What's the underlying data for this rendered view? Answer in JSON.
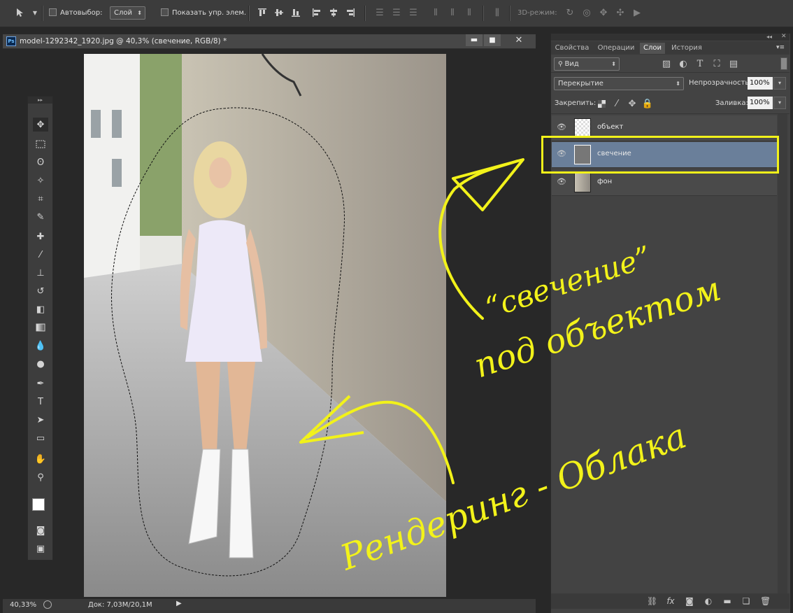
{
  "options_bar": {
    "autoselect_label": "Автовыбор:",
    "layer_select_value": "Слой",
    "show_controls_label": "Показать упр. элем.",
    "mode_3d_label": "3D-режим:"
  },
  "document": {
    "title": "model-1292342_1920.jpg @ 40,3% (свечение, RGB/8) *",
    "app_badge": "Ps",
    "zoom": "40,33%",
    "doc_info": "Док: 7,03M/20,1M"
  },
  "panel": {
    "tabs": [
      "Свойства",
      "Операции",
      "Слои",
      "История"
    ],
    "active_tab": "Слои",
    "filter_value": "Вид",
    "blend_mode": "Перекрытие",
    "opacity_label": "Непрозрачность:",
    "opacity_value": "100%",
    "lock_label": "Закрепить:",
    "fill_label": "Заливка:",
    "fill_value": "100%",
    "layers": [
      {
        "name": "объект",
        "selected": false
      },
      {
        "name": "свечение",
        "selected": true
      },
      {
        "name": "фон",
        "selected": false
      }
    ]
  },
  "annotations": {
    "quote_text": "“свечение”",
    "under_text": "под объектом",
    "render_text": "Рендеринг - Облака",
    "highlight_color": "#f2f21a"
  },
  "colors": {
    "selected_layer": "#6a7f9a",
    "panel_bg": "#434343"
  }
}
